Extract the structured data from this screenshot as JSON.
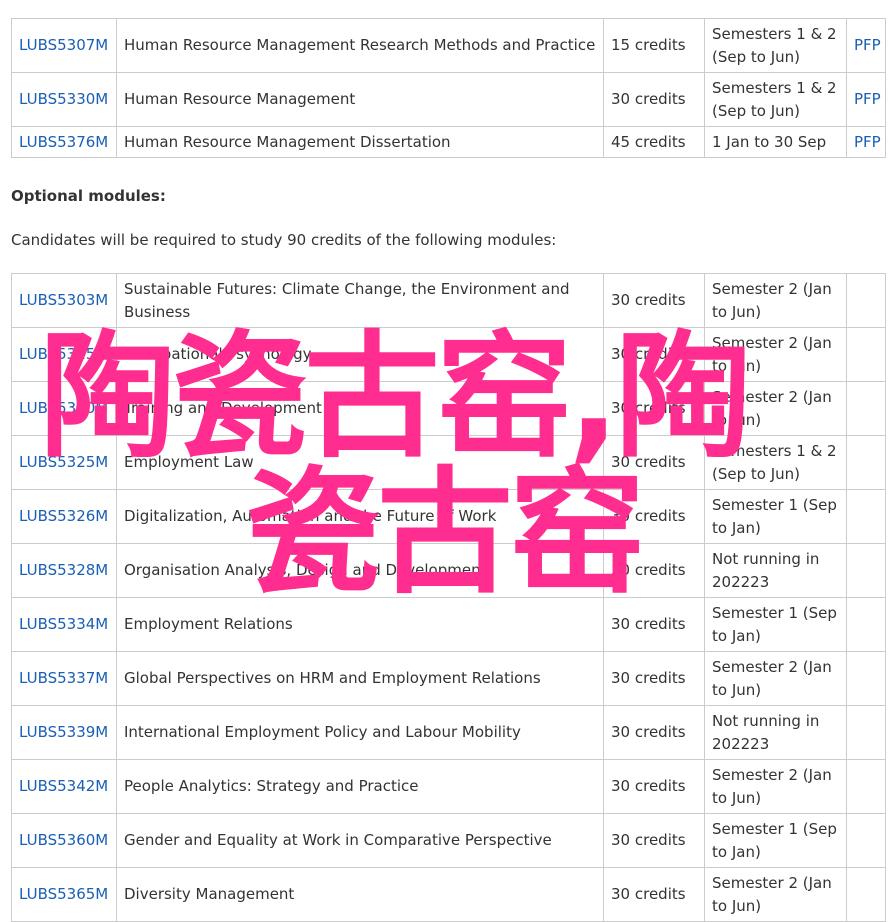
{
  "compulsory_modules": [
    {
      "code": "LUBS5307M",
      "title": "Human Resource Management Research Methods and Practice",
      "credits": "15 credits",
      "semester": "Semesters 1 & 2 (Sep to Jun)",
      "pfp": "PFP"
    },
    {
      "code": "LUBS5330M",
      "title": "Human Resource Management",
      "credits": "30 credits",
      "semester": "Semesters 1 & 2 (Sep to Jun)",
      "pfp": "PFP"
    },
    {
      "code": "LUBS5376M",
      "title": "Human Resource Management Dissertation",
      "credits": "45 credits",
      "semester": "1 Jan to 30 Sep",
      "pfp": "PFP"
    }
  ],
  "optional_heading": "Optional modules:",
  "optional_intro": "Candidates will be required to study 90 credits of the following modules:",
  "optional_modules": [
    {
      "code": "LUBS5303M",
      "title": "Sustainable Futures: Climate Change, the Environment and Business",
      "credits": "30 credits",
      "semester": "Semester 2 (Jan to Jun)"
    },
    {
      "code": "LUBS5315M",
      "title": "Occupational Psychology",
      "credits": "30 credits",
      "semester": "Semester 2 (Jan to Jun)"
    },
    {
      "code": "LUBS5320M",
      "title": "Training and Development",
      "credits": "30 credits",
      "semester": "Semester 2 (Jan to Jun)"
    },
    {
      "code": "LUBS5325M",
      "title": "Employment Law",
      "credits": "30 credits",
      "semester": "Semesters 1 & 2 (Sep to Jun)"
    },
    {
      "code": "LUBS5326M",
      "title": "Digitalization, Automation and the Future of Work",
      "credits": "30 credits",
      "semester": "Semester 1 (Sep to Jan)"
    },
    {
      "code": "LUBS5328M",
      "title": "Organisation Analysis, Design and Development",
      "credits": "30 credits",
      "semester": "Not running in 202223"
    },
    {
      "code": "LUBS5334M",
      "title": "Employment Relations",
      "credits": "30 credits",
      "semester": "Semester 1 (Sep to Jan)"
    },
    {
      "code": "LUBS5337M",
      "title": "Global Perspectives on HRM and Employment Relations",
      "credits": "30 credits",
      "semester": "Semester 2 (Jan to Jun)"
    },
    {
      "code": "LUBS5339M",
      "title": "International Employment Policy and Labour Mobility",
      "credits": "30 credits",
      "semester": "Not running in 202223"
    },
    {
      "code": "LUBS5342M",
      "title": "People Analytics: Strategy and Practice",
      "credits": "30 credits",
      "semester": "Semester 2 (Jan to Jun)"
    },
    {
      "code": "LUBS5360M",
      "title": "Gender and Equality at Work in Comparative Perspective",
      "credits": "30 credits",
      "semester": "Semester 1 (Sep to Jan)"
    },
    {
      "code": "LUBS5365M",
      "title": "Diversity Management",
      "credits": "30 credits",
      "semester": "Semester 2 (Jan to Jun)"
    }
  ],
  "watermark": {
    "line1": "陶瓷古窑,陶",
    "line2": "瓷古窑",
    "color": "#ff2d8f"
  }
}
